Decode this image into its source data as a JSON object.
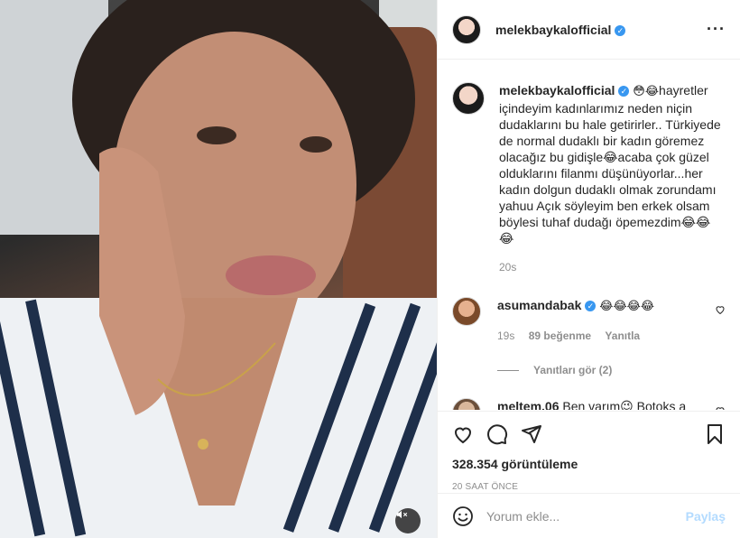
{
  "post": {
    "username": "melekbaykalofficial",
    "caption_emojis": "😳😂",
    "caption_text": "hayretler içindeyim kadınlarımız neden niçin dudaklarını bu hale getirirler.. Türkiyede de normal dudaklı bir kadın göremez olacağız bu gidişle😂acaba çok güzel olduklarını filanmı düşünüyorlar...her kadın dolgun dudaklı olmak zorundamı yahuu Açık söyleyim ben erkek olsam böylesi tuhaf dudağı öpemezdim😂😂😂",
    "caption_time": "20s",
    "views": "328.354 görüntüleme",
    "time_ago": "20 SAAT ÖNCE"
  },
  "comments": [
    {
      "username": "asumandabak",
      "text": "😂😂😂😂",
      "time": "19s",
      "likes": "89 beğenme",
      "reply": "Yanıtla",
      "view_replies": "Yanıtları gör (2)"
    },
    {
      "username": "meltem.06",
      "text": "Ben varım😉 Botoks a"
    }
  ],
  "add_comment": {
    "placeholder": "Yorum ekle...",
    "post_label": "Paylaş"
  },
  "colors": {
    "verified": "#3897f0",
    "link_disabled": "#b3dbff",
    "muted_text": "#8e8e8e"
  },
  "icons": [
    "more-options-icon",
    "heart-icon",
    "comment-icon",
    "share-icon",
    "bookmark-icon",
    "emoji-icon",
    "muted-icon",
    "verified-icon"
  ]
}
